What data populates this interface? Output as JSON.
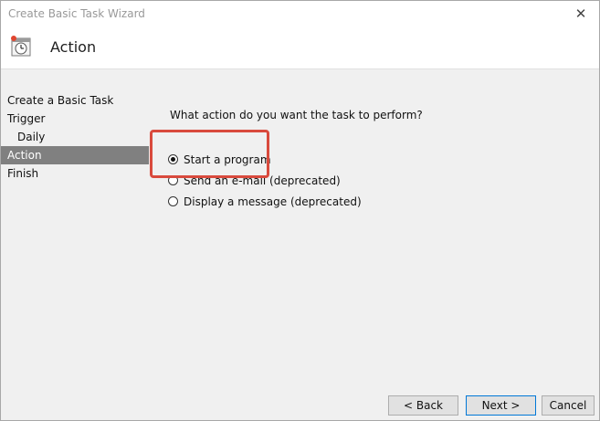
{
  "window": {
    "title": "Create Basic Task Wizard",
    "close_glyph": "✕"
  },
  "header": {
    "title": "Action",
    "icon": "task-scheduler-icon"
  },
  "sidebar": {
    "items": [
      {
        "label": "Create a Basic Task"
      },
      {
        "label": "Trigger"
      },
      {
        "label": "Daily"
      },
      {
        "label": "Action"
      },
      {
        "label": "Finish"
      }
    ],
    "selected": "Action"
  },
  "main": {
    "question": "What action do you want the task to perform?",
    "options": [
      {
        "label": "Start a program",
        "checked": true
      },
      {
        "label": "Send an e-mail (deprecated)",
        "checked": false
      },
      {
        "label": "Display a message (deprecated)",
        "checked": false
      }
    ]
  },
  "buttons": {
    "back": "< Back",
    "next": "Next >",
    "cancel": "Cancel"
  },
  "colors": {
    "highlight": "#d94a3d",
    "selected_nav": "#808080",
    "accent": "#0078d7"
  }
}
